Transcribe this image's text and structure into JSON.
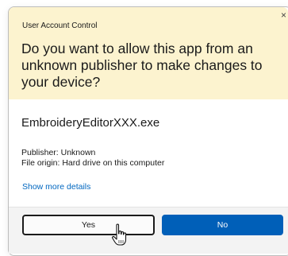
{
  "dialog": {
    "title": "User Account Control",
    "question": "Do you want to allow this app from an unknown publisher to make changes to your device?",
    "app_name": "EmbroideryEditorXXX.exe",
    "publisher": "Publisher: Unknown",
    "file_origin": "File origin: Hard drive on this computer",
    "more_details_link": "Show more details",
    "close_glyph": "×"
  },
  "buttons": {
    "yes_label": "Yes",
    "no_label": "No"
  },
  "colors": {
    "header_background": "#fcf3cf",
    "primary_button": "#005fb8",
    "link": "#0067c0",
    "footer_background": "#f3f3f3"
  },
  "icons": [
    "close-icon",
    "hand-pointer-cursor-icon"
  ]
}
